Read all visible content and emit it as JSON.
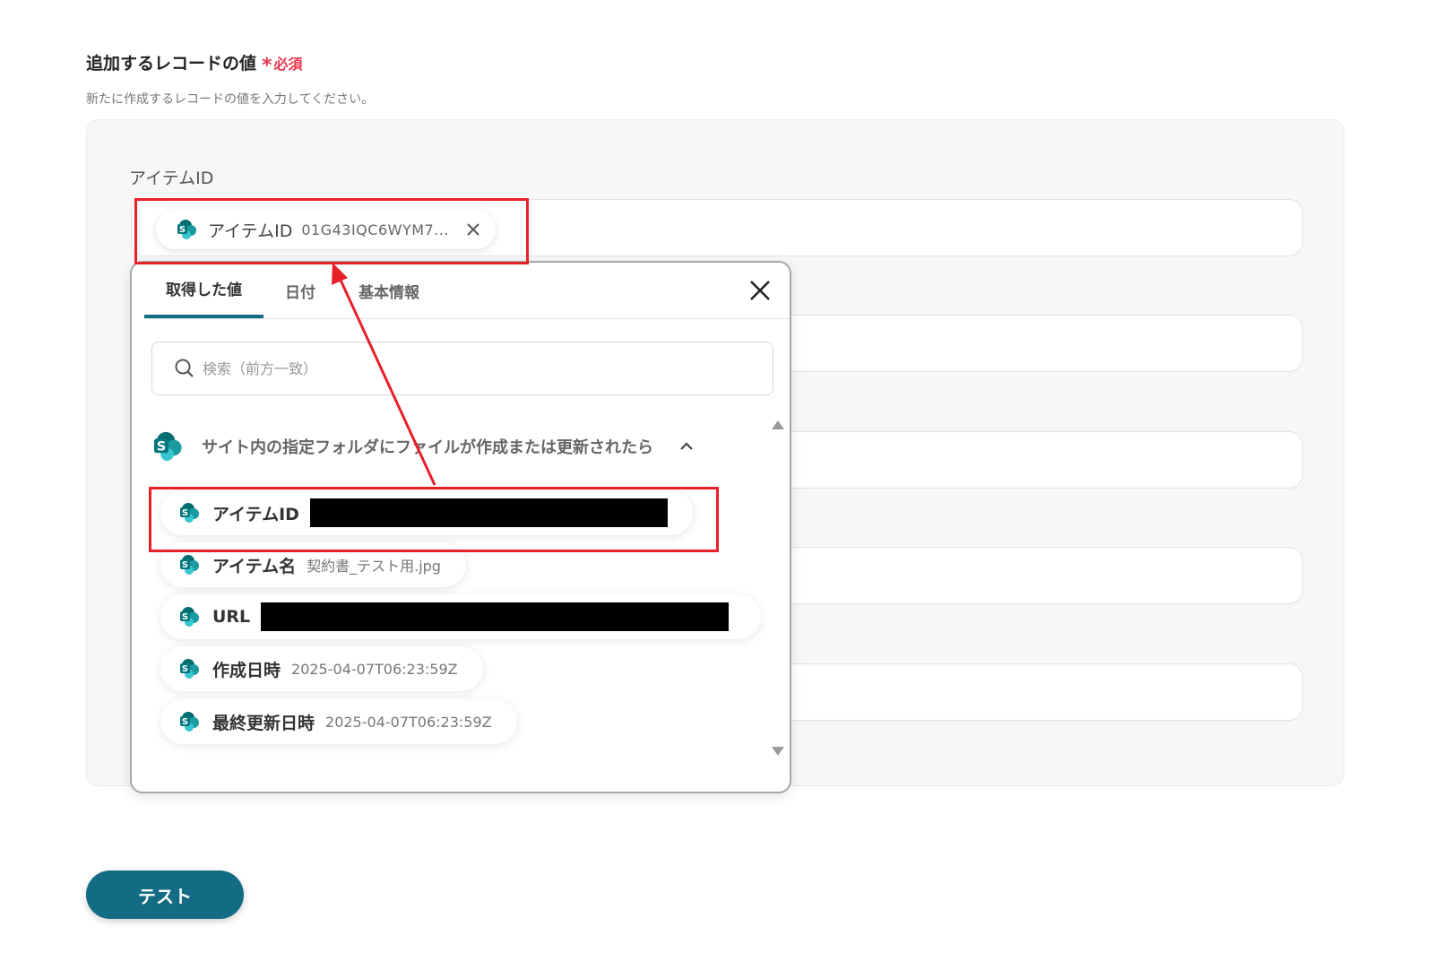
{
  "section": {
    "title": "追加するレコードの値",
    "asterisk": "*",
    "required": "必須",
    "description": "新たに作成するレコードの値を入力してください。"
  },
  "field": {
    "label": "アイテムID",
    "chip_label": "アイテムID",
    "chip_value": "01G43IQC6WYM7..."
  },
  "popup": {
    "tabs": [
      {
        "label": "取得した値",
        "active": true
      },
      {
        "label": "日付",
        "active": false
      },
      {
        "label": "基本情報",
        "active": false
      }
    ],
    "search_placeholder": "検索（前方一致）",
    "group_title": "サイト内の指定フォルダにファイルが作成または更新されたら",
    "items": [
      {
        "label": "アイテムID",
        "value": "",
        "redacted": true
      },
      {
        "label": "アイテム名",
        "value": "契約書_テスト用.jpg",
        "redacted": false
      },
      {
        "label": "URL",
        "value": "",
        "redacted": true
      },
      {
        "label": "作成日時",
        "value": "2025-04-07T06:23:59Z",
        "redacted": false
      },
      {
        "label": "最終更新日時",
        "value": "2025-04-07T06:23:59Z",
        "redacted": false
      }
    ]
  },
  "footer": {
    "test_label": "テスト"
  },
  "icons": {
    "app": "sharepoint-icon",
    "search": "search-icon",
    "close": "close-icon",
    "collapse": "chevron-up-icon",
    "scroll_up": "scroll-up-arrow-icon",
    "scroll_down": "scroll-down-arrow-icon"
  },
  "colors": {
    "accent": "#136c84",
    "required": "#e8364d",
    "highlight": "#e8202a",
    "sharepoint_dark": "#036c70",
    "sharepoint_mid": "#1a9ba1",
    "sharepoint_light": "#37c6d0"
  }
}
